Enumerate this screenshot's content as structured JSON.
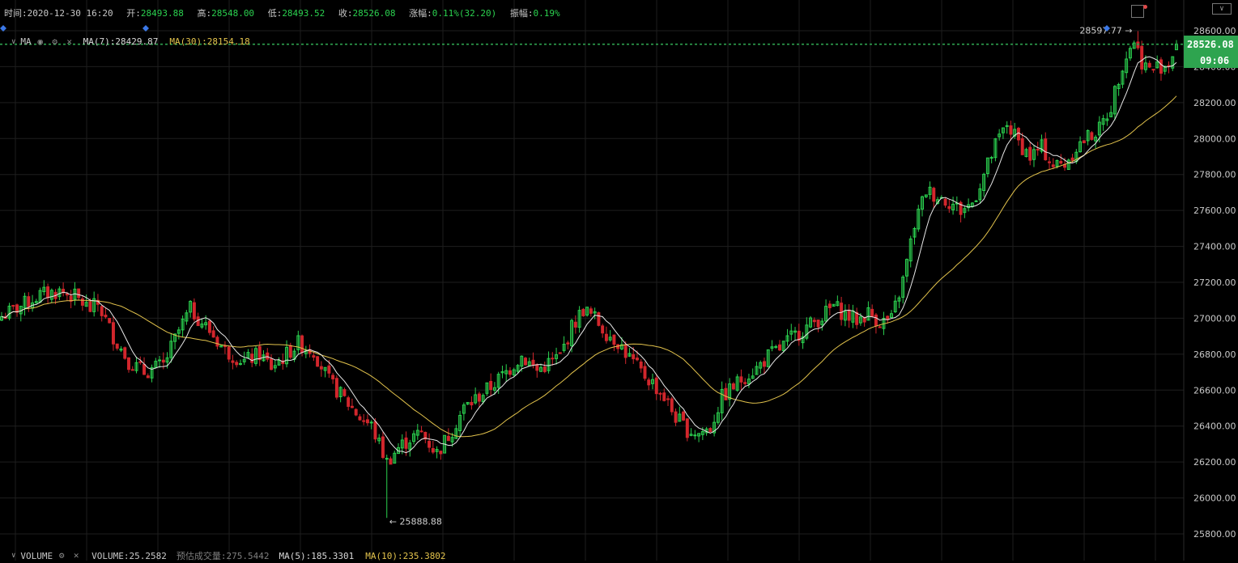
{
  "topbar": {
    "time_label": "时间:",
    "time_value": "2020-12-30 16:20",
    "open_label": "开:",
    "open_value": "28493.88",
    "high_label": "高:",
    "high_value": "28548.00",
    "low_label": "低:",
    "low_value": "28493.52",
    "close_label": "收:",
    "close_value": "28526.08",
    "change_label": "涨幅:",
    "change_value": "0.11%(32.20)",
    "amp_label": "振幅:",
    "amp_value": "0.19%"
  },
  "ma_bar": {
    "toggle": "∨",
    "name": "MA",
    "ma7": "MA(7):28429.87",
    "ma30": "MA(30):28154.18"
  },
  "vol_bar": {
    "toggle": "∨",
    "name": "VOLUME",
    "volume": "VOLUME:25.2582",
    "est_label": "预估成交量:",
    "est_value": "275.5442",
    "ma5": "MA(5):185.3301",
    "ma10": "MA(10):235.3802"
  },
  "price_tag": {
    "price": "28526.08",
    "time": "09:06"
  },
  "annotations": {
    "max_label": "28597.77 →",
    "min_label": "← 25888.88"
  },
  "colors": {
    "up": "#2bd14f",
    "down": "#d2262c",
    "ma7": "#e8e8e8",
    "ma30": "#e3c34c",
    "grid": "#1e1e1e",
    "accent_tag": "#2ea44f",
    "marker": "#3b78e7"
  },
  "icons": [
    "eye-icon",
    "settings-icon",
    "close-icon",
    "notification-icon",
    "chevron-down-icon"
  ],
  "chart_data": {
    "type": "candlestick",
    "y_axis_ticks": [
      "28600.00",
      "28400.00",
      "28200.00",
      "28000.00",
      "27800.00",
      "27600.00",
      "27400.00",
      "27200.00",
      "27000.00",
      "26800.00",
      "26600.00",
      "26400.00",
      "26200.00",
      "26000.00",
      "25800.00"
    ],
    "ylim": [
      25720,
      28690
    ],
    "current_price": 28526.08,
    "max": 28597.77,
    "min": 25888.88,
    "close_path": [
      [
        0,
        27010
      ],
      [
        6,
        27080
      ],
      [
        10,
        27130
      ],
      [
        15,
        27150
      ],
      [
        19,
        27120
      ],
      [
        23,
        27050
      ],
      [
        25,
        27080
      ],
      [
        29,
        26900
      ],
      [
        33,
        26760
      ],
      [
        37,
        26700
      ],
      [
        42,
        26740
      ],
      [
        46,
        26930
      ],
      [
        49,
        27050
      ],
      [
        54,
        26930
      ],
      [
        58,
        26820
      ],
      [
        63,
        26760
      ],
      [
        67,
        26800
      ],
      [
        70,
        26730
      ],
      [
        73,
        26780
      ],
      [
        77,
        26860
      ],
      [
        81,
        26820
      ],
      [
        85,
        26650
      ],
      [
        89,
        26550
      ],
      [
        93,
        26450
      ],
      [
        96,
        26400
      ],
      [
        100,
        26200
      ],
      [
        103,
        26280
      ],
      [
        106,
        26330
      ],
      [
        109,
        26360
      ],
      [
        113,
        26250
      ],
      [
        117,
        26380
      ],
      [
        120,
        26500
      ],
      [
        123,
        26550
      ],
      [
        127,
        26620
      ],
      [
        131,
        26700
      ],
      [
        135,
        26790
      ],
      [
        139,
        26710
      ],
      [
        142,
        26750
      ],
      [
        145,
        26790
      ],
      [
        148,
        26950
      ],
      [
        151,
        27050
      ],
      [
        154,
        27000
      ],
      [
        157,
        26920
      ],
      [
        160,
        26870
      ],
      [
        163,
        26780
      ],
      [
        166,
        26700
      ],
      [
        169,
        26640
      ],
      [
        172,
        26560
      ],
      [
        175,
        26450
      ],
      [
        178,
        26380
      ],
      [
        181,
        26360
      ],
      [
        184,
        26390
      ],
      [
        187,
        26560
      ],
      [
        190,
        26620
      ],
      [
        193,
        26680
      ],
      [
        196,
        26720
      ],
      [
        199,
        26790
      ],
      [
        202,
        26830
      ],
      [
        205,
        26890
      ],
      [
        209,
        26950
      ],
      [
        213,
        27010
      ],
      [
        216,
        27070
      ],
      [
        219,
        27020
      ],
      [
        222,
        26990
      ],
      [
        225,
        27030
      ],
      [
        228,
        26980
      ],
      [
        231,
        26990
      ],
      [
        234,
        27210
      ],
      [
        237,
        27520
      ],
      [
        240,
        27710
      ],
      [
        243,
        27680
      ],
      [
        246,
        27650
      ],
      [
        249,
        27600
      ],
      [
        252,
        27640
      ],
      [
        255,
        27800
      ],
      [
        258,
        27960
      ],
      [
        261,
        28080
      ],
      [
        264,
        27980
      ],
      [
        267,
        27900
      ],
      [
        270,
        27950
      ],
      [
        273,
        27850
      ],
      [
        276,
        27860
      ],
      [
        279,
        27950
      ],
      [
        282,
        28010
      ],
      [
        285,
        28050
      ],
      [
        288,
        28180
      ],
      [
        291,
        28420
      ],
      [
        294,
        28550
      ],
      [
        296,
        28430
      ],
      [
        298,
        28380
      ],
      [
        300,
        28400
      ],
      [
        303,
        28420
      ],
      [
        305,
        28526
      ]
    ]
  }
}
